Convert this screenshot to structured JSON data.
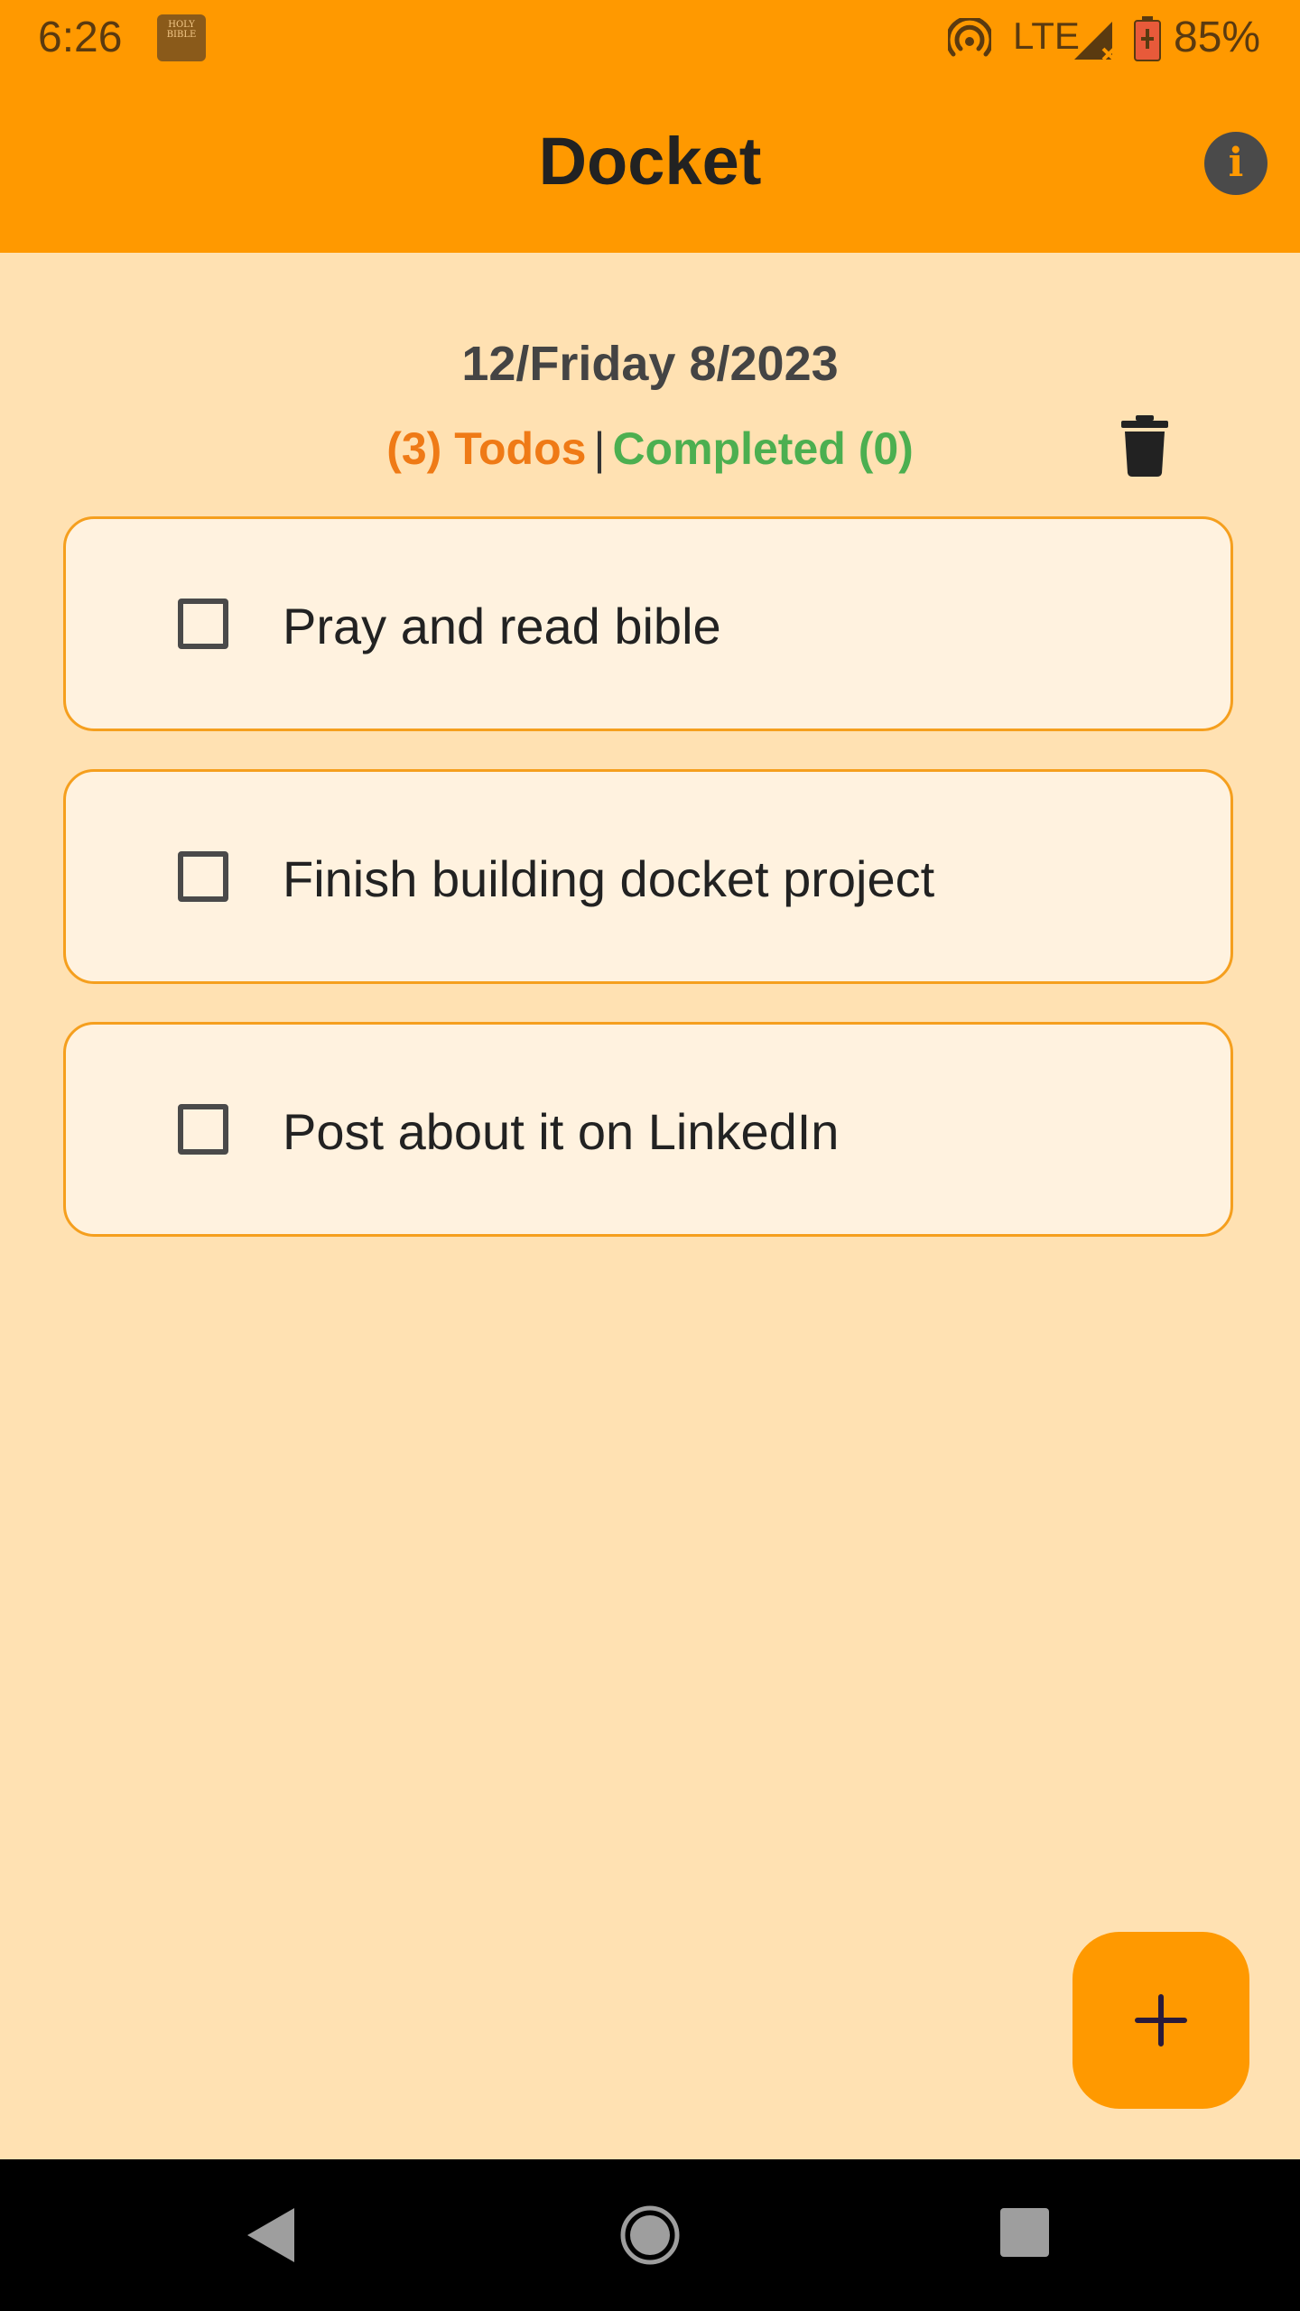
{
  "status_bar": {
    "time": "6:26",
    "network": "LTE",
    "battery": "85%",
    "icons": [
      "holy-bible-app-icon",
      "hotspot-icon",
      "signal-icon",
      "battery-charging-icon"
    ],
    "bible_icon_text": "HOLY BIBLE"
  },
  "app_bar": {
    "title": "Docket",
    "info_icon_glyph": "i"
  },
  "header": {
    "date": "12/Friday 8/2023",
    "todos_label": "(3) Todos",
    "separator": "|",
    "completed_label": "Completed (0)"
  },
  "todos": [
    {
      "text": "Pray and read bible",
      "checked": false
    },
    {
      "text": "Finish building docket project",
      "checked": false
    },
    {
      "text": "Post about it on LinkedIn",
      "checked": false
    }
  ],
  "fab": {
    "icon": "plus-icon"
  },
  "colors": {
    "primary": "#FF9900",
    "background": "#FFE1B2",
    "card": "#FFF2DF",
    "card_border": "#F59F1E",
    "todos_accent": "#EF7A16",
    "completed_accent": "#4CAF50"
  }
}
